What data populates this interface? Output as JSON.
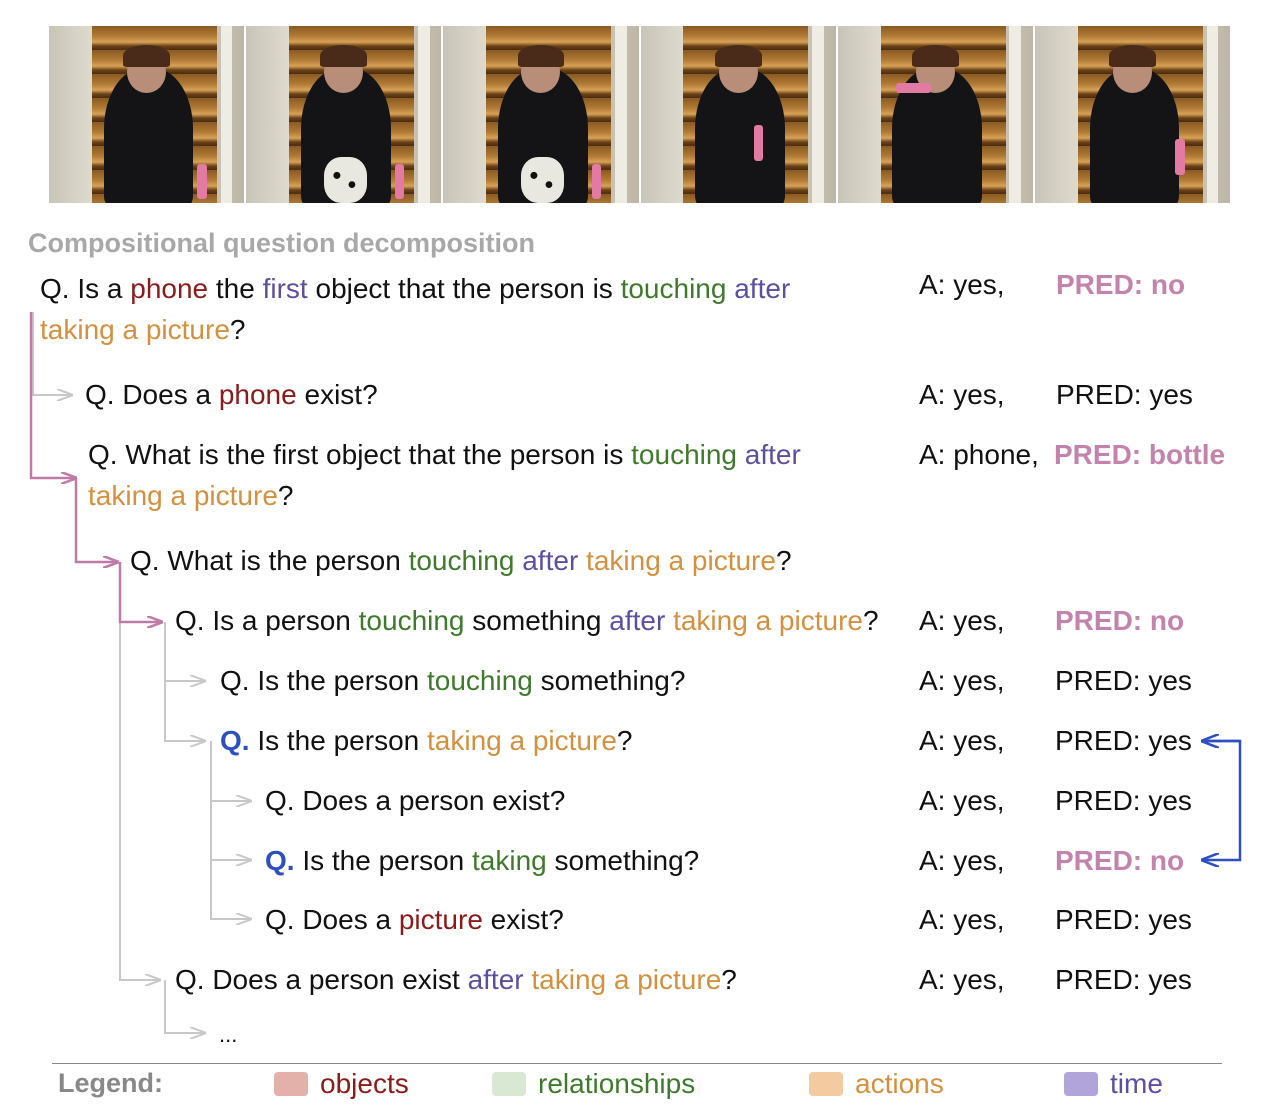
{
  "section_title": "Compositional question decomposition",
  "colors": {
    "objects": "#8b1a1a",
    "relationships": "#3f7a2c",
    "actions": "#d4903e",
    "time": "#5e4ea2",
    "highlight_q": "#2d4fc0",
    "wrong_pred": "#c383ad",
    "main_chain_line": "#c07aa8",
    "tree_line": "#c8c8c8",
    "blue_arrow": "#2d4fc0"
  },
  "rows": [
    {
      "q_prefix": "Q. Is a ",
      "t1": "phone",
      "t2": " the ",
      "t3": "first",
      "t4": " object that the person is ",
      "t5": "touching",
      "t6": " ",
      "t7": "after",
      "line2_t1": "taking a picture",
      "line2_t2": "?",
      "answer": "A: yes,",
      "pred": "PRED: no"
    },
    {
      "q_prefix": "Q. Does a ",
      "t1": "phone",
      "t2": " exist?",
      "answer": "A: yes,",
      "pred": "PRED: yes"
    },
    {
      "q_prefix": "Q. What is the first object that the person is ",
      "t1": "touching",
      "t2": " ",
      "t3": "after",
      "line2_t1": "taking a picture",
      "line2_t2": "?",
      "answer": "A: phone,",
      "pred": "PRED: bottle"
    },
    {
      "q_prefix": "Q. What is the person ",
      "t1": "touching",
      "t2": " ",
      "t3": "after",
      "t4": " ",
      "t5": "taking a picture",
      "t6": "?"
    },
    {
      "q_prefix": "Q. Is a person ",
      "t1": "touching",
      "t2": " something ",
      "t3": "after",
      "t4": " ",
      "t5": "taking a picture",
      "t6": "?",
      "answer": "A: yes,",
      "pred": "PRED: no"
    },
    {
      "q_prefix": "Q. Is the person ",
      "t1": "touching",
      "t2": " something?",
      "answer": "A: yes,",
      "pred": "PRED: yes"
    },
    {
      "q_label": "Q.",
      "q_prefix": " Is the person ",
      "t1": "taking a picture",
      "t2": "?",
      "answer": "A: yes,",
      "pred": "PRED: yes"
    },
    {
      "q_prefix": "Q. Does a person exist?",
      "answer": "A: yes,",
      "pred": "PRED: yes"
    },
    {
      "q_label": "Q.",
      "q_prefix": " Is the person ",
      "t1": "taking",
      "t2": " something?",
      "answer": "A: yes,",
      "pred": "PRED: no"
    },
    {
      "q_prefix": "Q. Does a ",
      "t1": "picture",
      "t2": " exist?",
      "answer": "A: yes,",
      "pred": "PRED: yes"
    },
    {
      "q_prefix": "Q. Does a person exist ",
      "t1": "after",
      "t2": " ",
      "t3": "taking a picture",
      "t4": "?",
      "answer": "A: yes,",
      "pred": "PRED: yes"
    },
    {
      "q_prefix": "..."
    }
  ],
  "legend": {
    "title": "Legend:",
    "items": [
      {
        "label": "objects",
        "swatch": "#e3b0aa",
        "text_color": "#8b1a1a"
      },
      {
        "label": "relationships",
        "swatch": "#d9e8d2",
        "text_color": "#3f7a2c"
      },
      {
        "label": "actions",
        "swatch": "#f4caa0",
        "text_color": "#d4903e"
      },
      {
        "label": "time",
        "swatch": "#b0a4d8",
        "text_color": "#5e4ea2"
      }
    ]
  }
}
